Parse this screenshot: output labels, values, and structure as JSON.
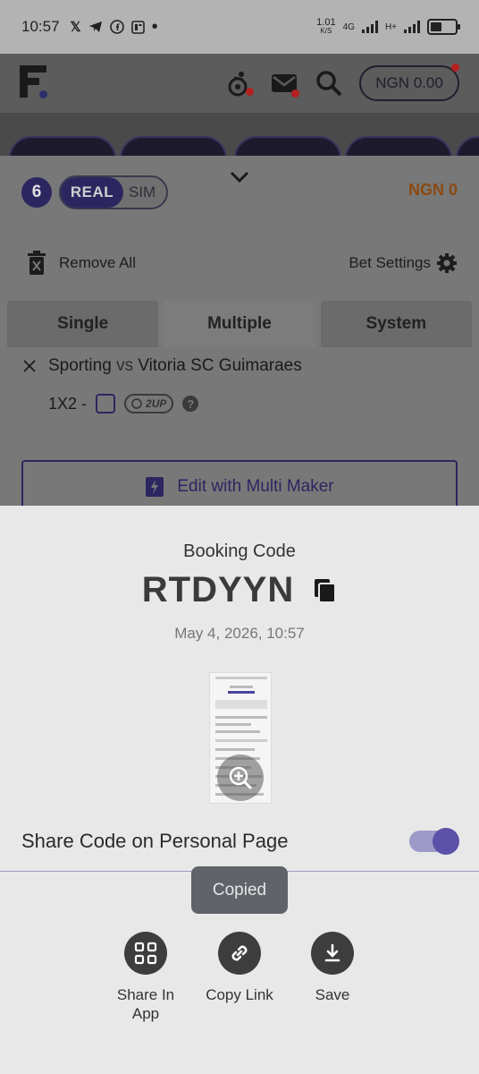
{
  "status_bar": {
    "time": "10:57",
    "speed_value": "1.01",
    "speed_unit": "K/S",
    "net1": "4G",
    "net2": "H+",
    "battery_level": 0.45
  },
  "header": {
    "balance": "NGN 0.00"
  },
  "betslip": {
    "count": "6",
    "mode_real": "REAL",
    "mode_sim": "SIM",
    "balance": "NGN 0",
    "remove_all": "Remove All",
    "bet_settings": "Bet Settings",
    "tabs": [
      {
        "label": "Single"
      },
      {
        "label": "Multiple"
      },
      {
        "label": "System"
      }
    ],
    "selection": {
      "home": "Sporting",
      "vs": "vs",
      "away": "Vitoria SC Guimaraes",
      "market": "1X2 -",
      "badge": "2UP",
      "help": "?"
    },
    "multi_maker": "Edit with Multi Maker"
  },
  "sheet": {
    "booking_label": "Booking Code",
    "booking_code": "RTDYYN",
    "date": "May 4, 2026, 10:57",
    "share_label": "Share Code on Personal Page",
    "share_enabled": true,
    "toast": "Copied",
    "actions": [
      {
        "label": "Share In App",
        "icon": "grid-icon"
      },
      {
        "label": "Copy Link",
        "icon": "link-icon"
      },
      {
        "label": "Save",
        "icon": "download-icon"
      }
    ]
  },
  "colors": {
    "accent": "#2c2660",
    "toggle_knob": "#5b51a8",
    "balance_orange": "#8a4a10"
  }
}
